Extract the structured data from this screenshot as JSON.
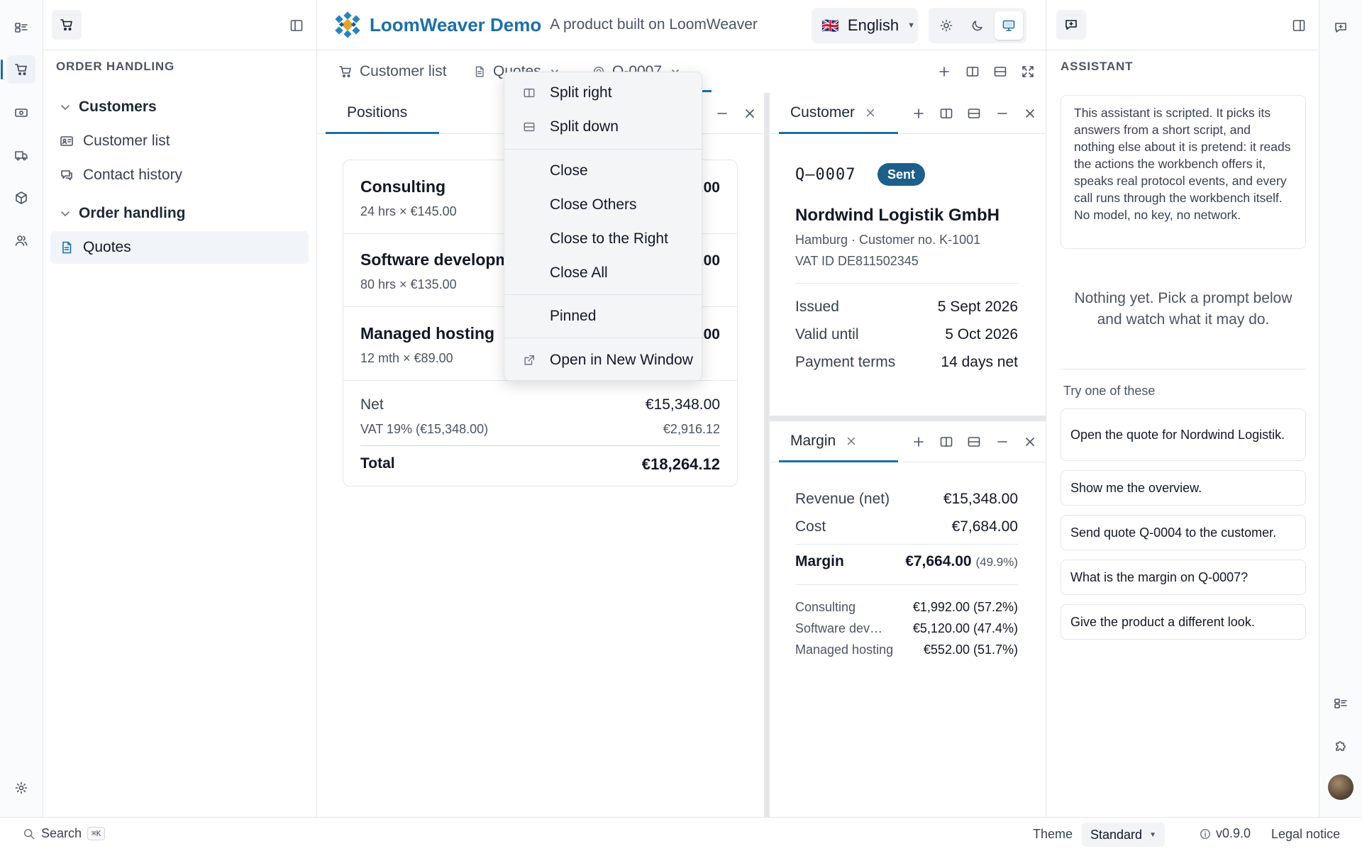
{
  "header": {
    "brand_name": "LoomWeaver Demo",
    "brand_tagline": "A product built on LoomWeaver",
    "language": "English",
    "language_flag": "🇬🇧",
    "theme_modes": [
      "light",
      "dark",
      "system"
    ],
    "theme_active": "system"
  },
  "sidebar": {
    "section_title": "ORDER HANDLING",
    "groups": [
      {
        "label": "Customers",
        "items": [
          {
            "label": "Customer list",
            "icon": "id-card-icon"
          },
          {
            "label": "Contact history",
            "icon": "chat-icon"
          }
        ]
      },
      {
        "label": "Order handling",
        "items": [
          {
            "label": "Quotes",
            "icon": "document-icon",
            "selected": true
          }
        ]
      }
    ]
  },
  "editor_tabs": {
    "items": [
      {
        "label": "Customer list"
      },
      {
        "label": "Quotes"
      },
      {
        "label": "Q-0007"
      }
    ]
  },
  "positions": {
    "tab_label": "Positions",
    "lines": [
      {
        "name": "Consulting",
        "detail": "24 hrs × €145.00",
        "amount": "€3,480.00"
      },
      {
        "name": "Software development",
        "detail": "80 hrs × €135.00",
        "amount": "€10,800.00"
      },
      {
        "name": "Managed hosting",
        "detail": "12 mth × €89.00",
        "amount": "€1,068.00"
      }
    ],
    "net_label": "Net",
    "net_value": "€15,348.00",
    "vat_label": "VAT 19% (€15,348.00)",
    "vat_value": "€2,916.12",
    "total_label": "Total",
    "total_value": "€18,264.12"
  },
  "context_menu": {
    "split_right": "Split right",
    "split_down": "Split down",
    "close": "Close",
    "close_others": "Close Others",
    "close_right": "Close to the Right",
    "close_all": "Close All",
    "pinned": "Pinned",
    "open_new_window": "Open in New Window"
  },
  "customer": {
    "tab_label": "Customer",
    "quote_id": "Q–0007",
    "status": "Sent",
    "name": "Nordwind Logistik GmbH",
    "location_line": "Hamburg · Customer no. K-1001",
    "vat_line": "VAT ID DE811502345",
    "issued_label": "Issued",
    "issued_value": "5 Sept 2026",
    "valid_label": "Valid until",
    "valid_value": "5 Oct 2026",
    "terms_label": "Payment terms",
    "terms_value": "14 days net"
  },
  "margin": {
    "tab_label": "Margin",
    "revenue_label": "Revenue (net)",
    "revenue_value": "€15,348.00",
    "cost_label": "Cost",
    "cost_value": "€7,684.00",
    "margin_label": "Margin",
    "margin_value": "€7,664.00",
    "margin_pct": "(49.9%)",
    "breakdown": [
      {
        "label": "Consulting",
        "value": "€1,992.00 (57.2%)"
      },
      {
        "label": "Software dev…",
        "value": "€5,120.00 (47.4%)"
      },
      {
        "label": "Managed hosting",
        "value": "€552.00 (51.7%)"
      }
    ]
  },
  "assistant": {
    "title": "ASSISTANT",
    "intro": "This assistant is scripted. It picks its answers from a short script, and nothing else about it is pretend: it reads the actions the workbench offers it, speaks real protocol events, and every call runs through the workbench itself. No model, no key, no network.",
    "empty": "Nothing yet. Pick a prompt below and watch what it may do.",
    "try_label": "Try one of these",
    "suggestions": [
      "Open the quote for Nordwind Logistik.",
      "Show me the overview.",
      "Send quote Q-0004 to the customer.",
      "What is the margin on Q-0007?",
      "Give the product a different look."
    ]
  },
  "status_bar": {
    "search_label": "Search",
    "search_shortcut": "⌘K",
    "theme_label": "Theme",
    "theme_value": "Standard",
    "version": "v0.9.0",
    "legal": "Legal notice"
  },
  "colors": {
    "accent": "#1d6fa5",
    "badge": "#1d5f8a"
  }
}
